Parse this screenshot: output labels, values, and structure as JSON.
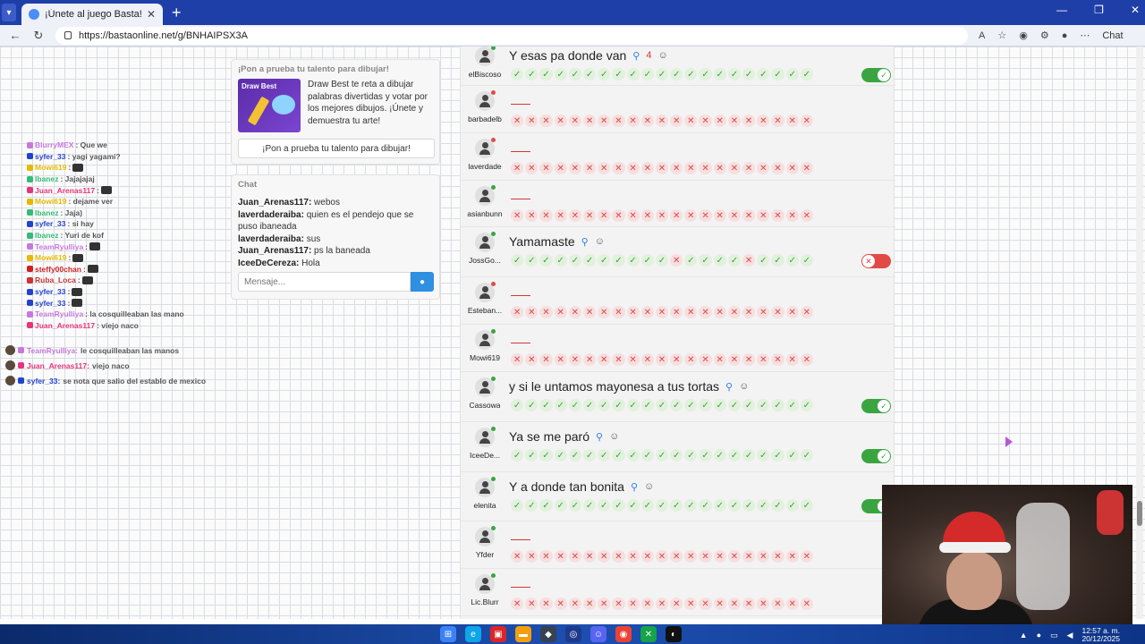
{
  "browser": {
    "tab_title": "¡Únete al juego Basta!",
    "url": "https://bastaonline.net/g/BNHAIPSX3A",
    "chat_label": "Chat"
  },
  "promo": {
    "header": "¡Pon a prueba tu talento para dibujar!",
    "image_title": "Draw Best",
    "text": "Draw Best te reta a dibujar palabras divertidas y votar por los mejores dibujos. ¡Únete y demuestra tu arte!",
    "button": "¡Pon a prueba tu talento para dibujar!"
  },
  "chat": {
    "header": "Chat",
    "messages": [
      {
        "user": "Juan_Arenas117:",
        "text": " webos"
      },
      {
        "user": "laverdaderaiba:",
        "text": " quien es el pendejo que se puso ibaneada"
      },
      {
        "user": "laverdaderaiba:",
        "text": " sus"
      },
      {
        "user": "Juan_Arenas117:",
        "text": " ps la baneada"
      },
      {
        "user": "IceeDeCereza:",
        "text": " Hola"
      }
    ],
    "input_placeholder": "Mensaje..."
  },
  "overlay_chat": [
    {
      "user": "BlurryMEX",
      "msg": ": Que we",
      "color": "#c678dd"
    },
    {
      "user": "syfer_33",
      "msg": ": yagi yagami?",
      "color": "#2244cc"
    },
    {
      "user": "Mowi619",
      "msg": ":",
      "color": "#e6b800"
    },
    {
      "user": "Ibanez",
      "msg": ": Jajajajaj",
      "color": "#33bb77"
    },
    {
      "user": "Juan_Arenas117",
      "msg": ":",
      "color": "#e6357a"
    },
    {
      "user": "Mowi619",
      "msg": ": dejame ver",
      "color": "#e6b800"
    },
    {
      "user": "Ibanez",
      "msg": ": Jaja)",
      "color": "#33bb77"
    },
    {
      "user": "syfer_33",
      "msg": ": si hay",
      "color": "#2244cc"
    },
    {
      "user": "Ibanez",
      "msg": ": Yuri de kof",
      "color": "#33bb77"
    },
    {
      "user": "TeamRyuIliya",
      "msg": ":",
      "color": "#c678dd"
    },
    {
      "user": "Mowi619",
      "msg": ":",
      "color": "#e6b800"
    },
    {
      "user": "steffy00chan",
      "msg": ":",
      "color": "#cc2222"
    },
    {
      "user": "Ruba_Loca",
      "msg": ":",
      "color": "#cc3333"
    },
    {
      "user": "syfer_33",
      "msg": ":",
      "color": "#2244cc"
    },
    {
      "user": "syfer_33",
      "msg": ":",
      "color": "#2244cc"
    },
    {
      "user": "TeamRyuIliya",
      "msg": ": la cosquilleaban las mano",
      "color": "#c678dd"
    },
    {
      "user": "Juan_Arenas117",
      "msg": ": viejo naco",
      "color": "#e6357a"
    }
  ],
  "overlay_chat2": [
    {
      "user": "TeamRyuIliya:",
      "msg": " le cosquilleaban las manos",
      "color": "#c678dd"
    },
    {
      "user": "Juan_Arenas117:",
      "msg": " viejo naco",
      "color": "#e6357a"
    },
    {
      "user": "syfer_33:",
      "msg": " se nota que salio del establo de mexico",
      "color": "#2244cc"
    }
  ],
  "answers": [
    {
      "player": "elBiscoso",
      "dot": "#3aa540",
      "answer": "Y esas pa donde van",
      "heart": "4",
      "votes": "VVVVVVVVVVVVVVVVVVVVV",
      "toggle": "on"
    },
    {
      "player": "barbadelb",
      "dot": "#e24a46",
      "answer": "",
      "votes": "XXXXXXXXXXXXXXXXXXXXX",
      "toggle": ""
    },
    {
      "player": "laverdade",
      "dot": "#e24a46",
      "answer": "",
      "votes": "XXXXXXXXXXXXXXXXXXXXX",
      "toggle": ""
    },
    {
      "player": "asianbunn",
      "dot": "#3aa540",
      "answer": "",
      "votes": "XXXXXXXXXXXXXXXXXXXXX",
      "toggle": ""
    },
    {
      "player": "JossGo...",
      "dot": "#3aa540",
      "answer": "Yamamaste",
      "votes": "VVVVVVVVVVVXVVVVXVVVV",
      "toggle": "off"
    },
    {
      "player": "Esteban...",
      "dot": "#e24a46",
      "answer": "",
      "votes": "XXXXXXXXXXXXXXXXXXXXX",
      "toggle": ""
    },
    {
      "player": "Mowi619",
      "dot": "#3aa540",
      "answer": "",
      "votes": "XXXXXXXXXXXXXXXXXXXXX",
      "toggle": ""
    },
    {
      "player": "Cassowa",
      "dot": "#3aa540",
      "answer": "y si le untamos mayonesa a tus tortas",
      "votes": "VVVVVVVVVVVVVVVVVVVVV",
      "toggle": "on"
    },
    {
      "player": "IceeDe...",
      "dot": "#3aa540",
      "answer": "Ya se me paró",
      "votes": "VVVVVVVVVVVVVVVVVVVVV",
      "toggle": "on"
    },
    {
      "player": "elenita",
      "dot": "#3aa540",
      "answer": "Y a donde tan bonita",
      "votes": "VVVVVVVVVVVVVVVVVVVVV",
      "toggle": "on"
    },
    {
      "player": "Yfder",
      "dot": "#3aa540",
      "answer": "",
      "votes": "XXXXXXXXXXXXXXXXXXXXX",
      "toggle": ""
    },
    {
      "player": "Lic.Blurr",
      "dot": "#3aa540",
      "answer": "",
      "votes": "XXXXXXXXXXXXXXXXXXXXX",
      "toggle": ""
    }
  ],
  "taskbar": {
    "time": "12:57 a. m.",
    "date": "20/12/2025"
  }
}
